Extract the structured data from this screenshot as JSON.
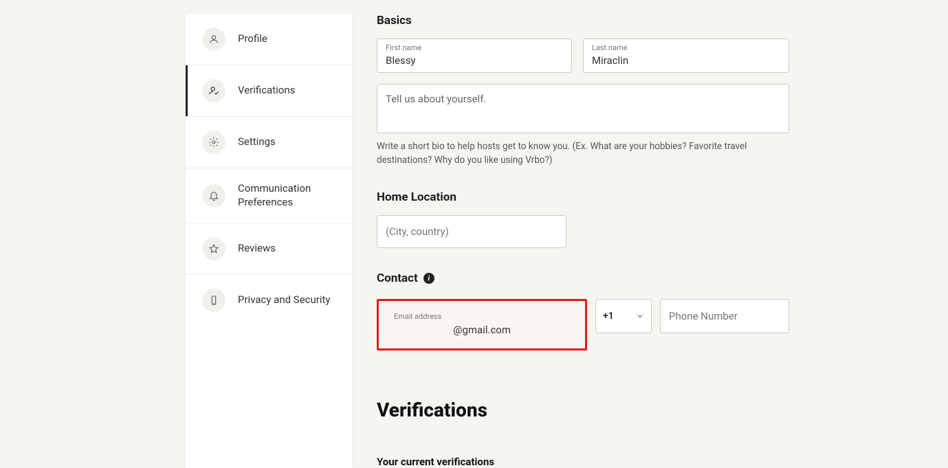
{
  "sidebar": {
    "items": [
      {
        "label": "Profile"
      },
      {
        "label": "Verifications"
      },
      {
        "label": "Settings"
      },
      {
        "label": "Communication Preferences"
      },
      {
        "label": "Reviews"
      },
      {
        "label": "Privacy and Security"
      }
    ]
  },
  "basics": {
    "heading": "Basics",
    "first_name_label": "First name",
    "first_name_value": "Blessy",
    "last_name_label": "Last name",
    "last_name_value": "Miraclin",
    "bio_placeholder": "Tell us about yourself.",
    "bio_helper": "Write a short bio to help hosts get to know you. (Ex. What are your hobbies? Favorite travel destinations? Why do you like using Vrbo?)"
  },
  "home": {
    "heading": "Home Location",
    "placeholder": "(City, country)"
  },
  "contact": {
    "heading": "Contact",
    "email_label": "Email address",
    "email_value": "@gmail.com",
    "country_code": "+1",
    "phone_placeholder": "Phone Number"
  },
  "verifications": {
    "heading": "Verifications",
    "sub": "Your current verifications"
  }
}
